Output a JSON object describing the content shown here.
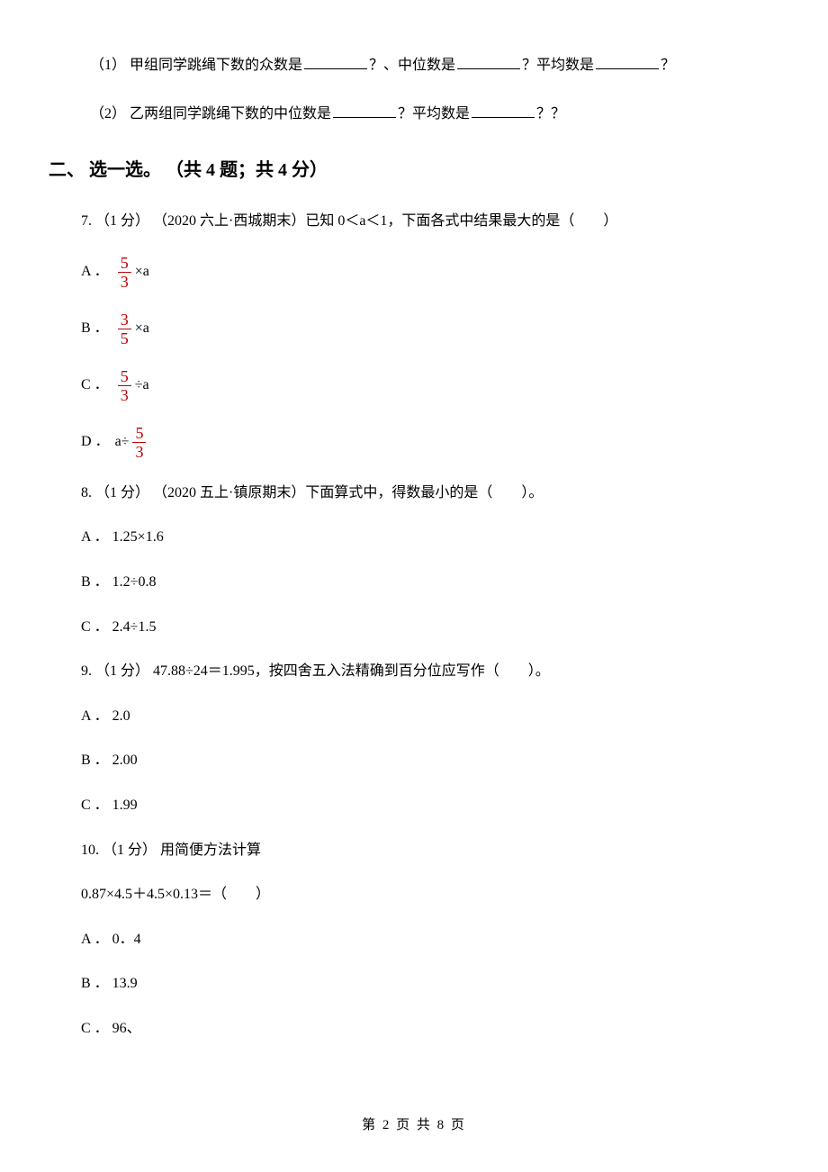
{
  "sub_questions": {
    "sq1": {
      "prefix": "（1） 甲组同学跳绳下数的众数是",
      "mid1": "？、中位数是",
      "mid2": "？平均数是",
      "suffix": "？"
    },
    "sq2": {
      "prefix": "（2） 乙两组同学跳绳下数的中位数是",
      "mid1": "？平均数是",
      "suffix": "？？"
    }
  },
  "section2_heading": "二、 选一选。 （共 4 题；共 4 分）",
  "q7": {
    "stem": "7. （1 分） （2020 六上·西城期末）已知 0＜a＜1，下面各式中结果最大的是（　　）",
    "A": {
      "label": "A ．",
      "frac_num": "5",
      "frac_den": "3",
      "tail": " ×a"
    },
    "B": {
      "label": "B ．",
      "frac_num": "3",
      "frac_den": "5",
      "tail": " ×a"
    },
    "C": {
      "label": "C ．",
      "frac_num": "5",
      "frac_den": "3",
      "tail": " ÷a"
    },
    "D": {
      "label": "D ．",
      "pre": "a÷ ",
      "frac_num": "5",
      "frac_den": "3"
    }
  },
  "q8": {
    "stem": "8. （1 分） （2020 五上·镇原期末）下面算式中，得数最小的是（　　）。",
    "A": "A ． 1.25×1.6",
    "B": "B ． 1.2÷0.8",
    "C": "C ． 2.4÷1.5"
  },
  "q9": {
    "stem": "9. （1 分）  47.88÷24＝1.995，按四舍五入法精确到百分位应写作（　　）。",
    "A": "A ． 2.0",
    "B": "B ． 2.00",
    "C": "C ． 1.99"
  },
  "q10": {
    "stem": "10. （1 分）  用简便方法计算",
    "expr": "0.87×4.5＋4.5×0.13＝（　　）",
    "A": "A ． 0．4",
    "B": "B ． 13.9",
    "C": "C ． 96、"
  },
  "footer": "第 2 页 共 8 页"
}
